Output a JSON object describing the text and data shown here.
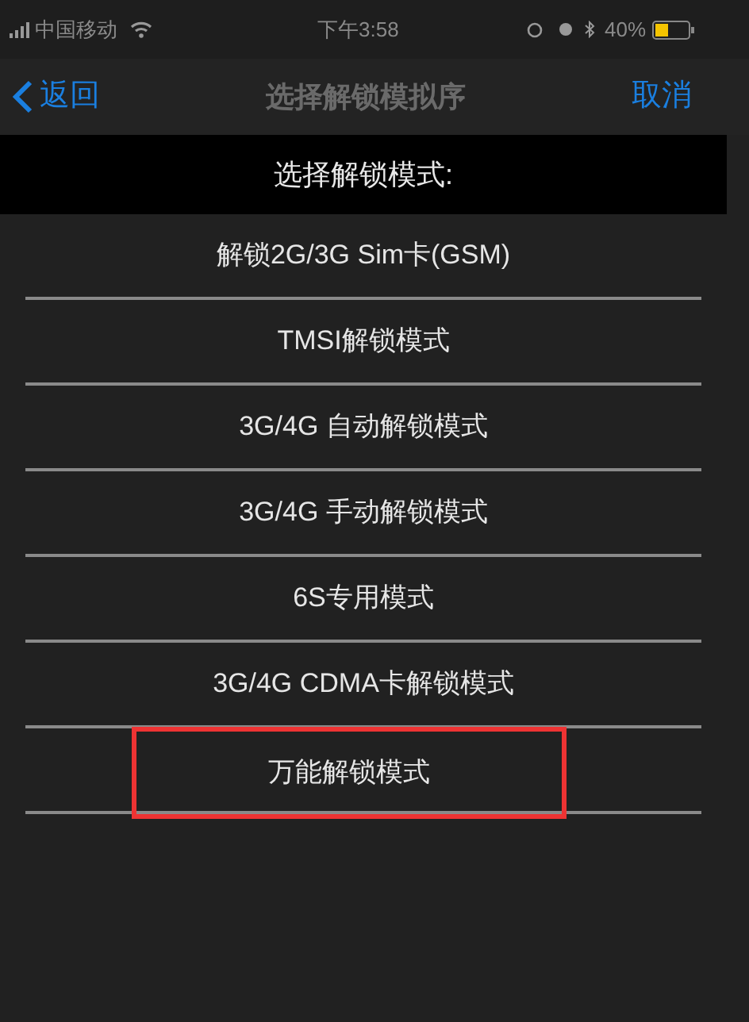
{
  "status_bar": {
    "carrier": "中国移动",
    "time": "下午3:58",
    "battery": "40%"
  },
  "nav": {
    "back": "返回",
    "title": "选择解锁模拟序",
    "cancel": "取消"
  },
  "picker": {
    "title": "选择解锁模式:",
    "options": [
      {
        "label": "解锁2G/3G Sim卡(GSM)",
        "selected": false
      },
      {
        "label": "TMSI解锁模式",
        "selected": false
      },
      {
        "label": "3G/4G 自动解锁模式",
        "selected": false
      },
      {
        "label": "3G/4G 手动解锁模式",
        "selected": false
      },
      {
        "label": "6S专用模式",
        "selected": false
      },
      {
        "label": "3G/4G CDMA卡解锁模式",
        "selected": false
      },
      {
        "label": "万能解锁模式",
        "selected": true
      }
    ]
  }
}
